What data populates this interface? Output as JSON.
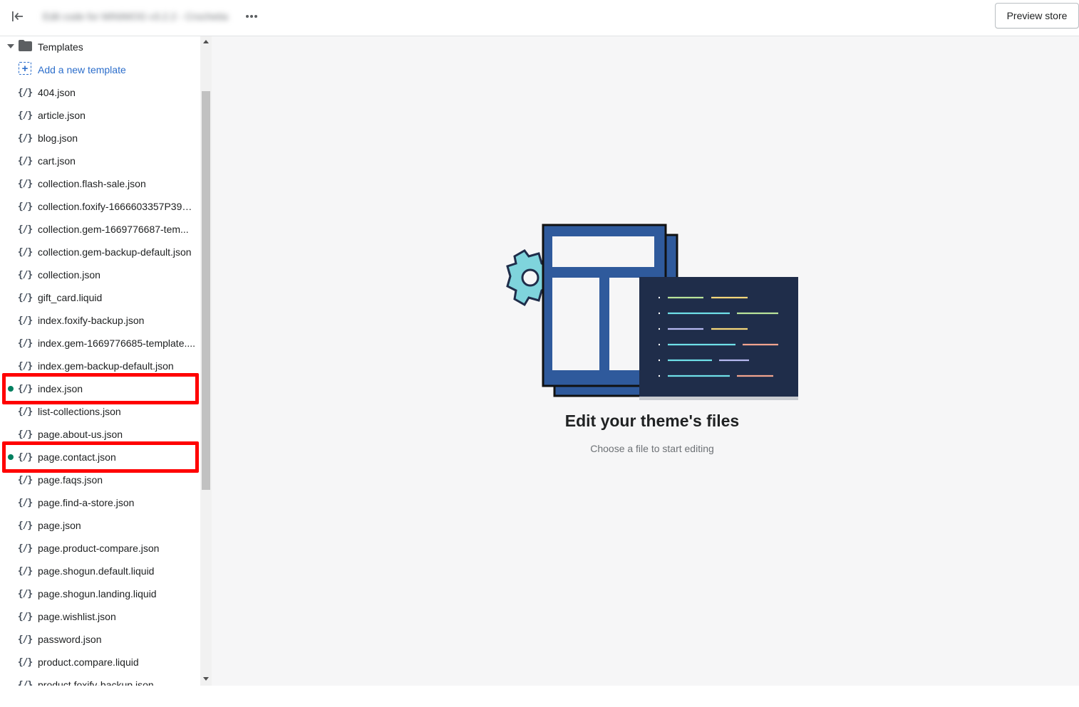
{
  "topbar": {
    "exit_icon": "exit-icon",
    "title": "Edit code for MINIMOG v3.2.2 - Crochetia",
    "more_icon": "more-horizontal-icon",
    "preview_label": "Preview store"
  },
  "sidebar": {
    "folder": {
      "label": "Templates",
      "icon": "folder-icon",
      "expanded": true
    },
    "add_template_label": "Add a new template",
    "file_icon_glyph": "{/}",
    "files": [
      {
        "label": "404.json",
        "modified": false
      },
      {
        "label": "article.json",
        "modified": false
      },
      {
        "label": "blog.json",
        "modified": false
      },
      {
        "label": "cart.json",
        "modified": false
      },
      {
        "label": "collection.flash-sale.json",
        "modified": false
      },
      {
        "label": "collection.foxify-1666603357P39S...",
        "modified": false
      },
      {
        "label": "collection.gem-1669776687-tem...",
        "modified": false
      },
      {
        "label": "collection.gem-backup-default.json",
        "modified": false
      },
      {
        "label": "collection.json",
        "modified": false
      },
      {
        "label": "gift_card.liquid",
        "modified": false
      },
      {
        "label": "index.foxify-backup.json",
        "modified": false
      },
      {
        "label": "index.gem-1669776685-template....",
        "modified": false
      },
      {
        "label": "index.gem-backup-default.json",
        "modified": false
      },
      {
        "label": "index.json",
        "modified": true,
        "highlighted": true
      },
      {
        "label": "list-collections.json",
        "modified": false
      },
      {
        "label": "page.about-us.json",
        "modified": false
      },
      {
        "label": "page.contact.json",
        "modified": true,
        "highlighted": true
      },
      {
        "label": "page.faqs.json",
        "modified": false
      },
      {
        "label": "page.find-a-store.json",
        "modified": false
      },
      {
        "label": "page.json",
        "modified": false
      },
      {
        "label": "page.product-compare.json",
        "modified": false
      },
      {
        "label": "page.shogun.default.liquid",
        "modified": false
      },
      {
        "label": "page.shogun.landing.liquid",
        "modified": false
      },
      {
        "label": "page.wishlist.json",
        "modified": false
      },
      {
        "label": "password.json",
        "modified": false
      },
      {
        "label": "product.compare.liquid",
        "modified": false
      },
      {
        "label": "product.foxify-backup.json",
        "modified": false
      }
    ]
  },
  "main": {
    "title": "Edit your theme's files",
    "subtitle": "Choose a file to start editing"
  },
  "colors": {
    "accent": "#2c6ecb",
    "modified_dot": "#007f5f",
    "highlight": "#ff0000",
    "illustration_blue": "#2f5a9c",
    "illustration_navy": "#1f2d4a",
    "gear": "#7fd4dc"
  }
}
